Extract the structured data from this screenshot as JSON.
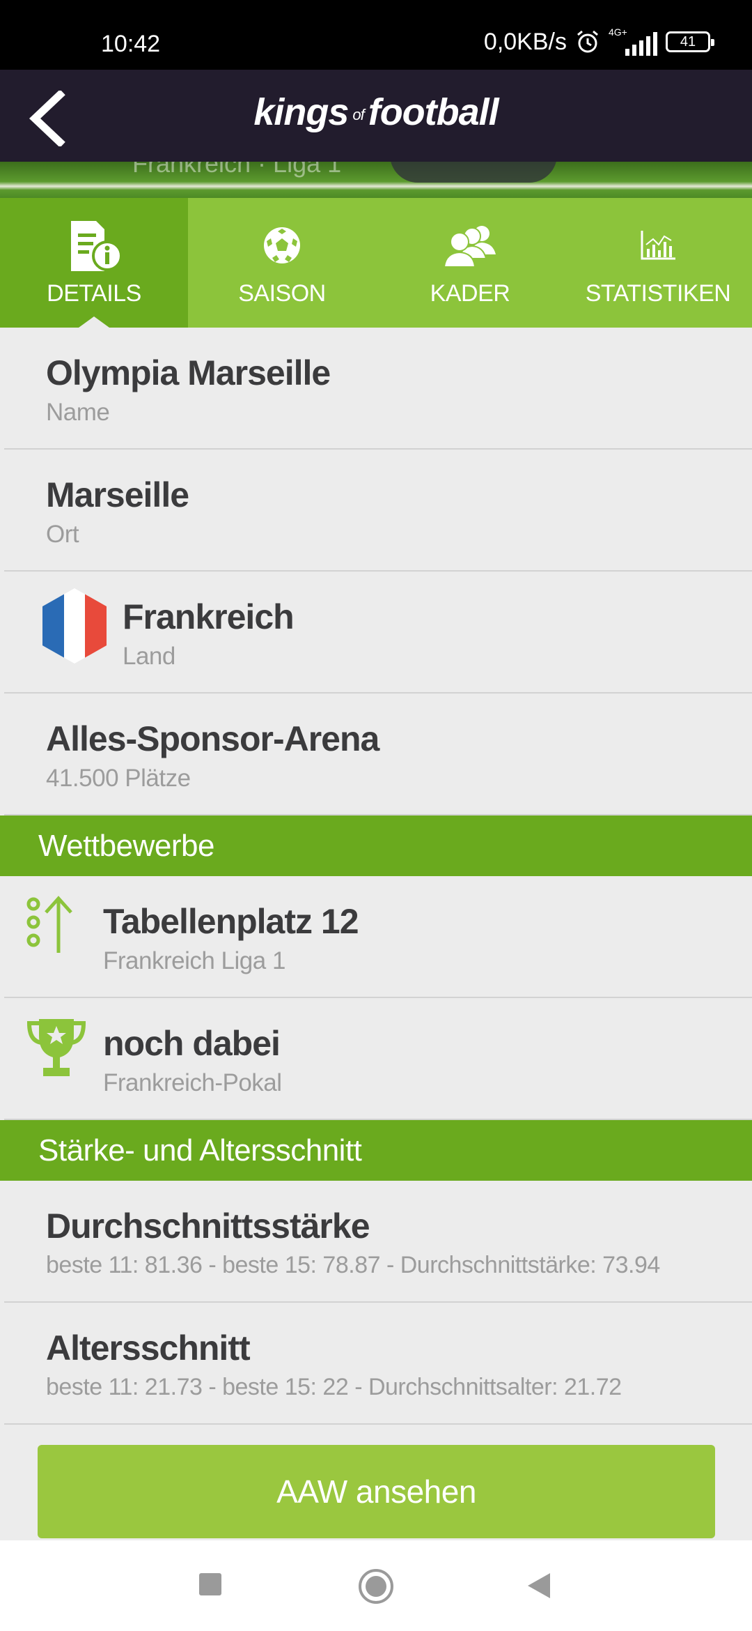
{
  "status_bar": {
    "time": "10:42",
    "network_speed": "0,0KB/s",
    "network_type": "4G+",
    "battery": "41"
  },
  "app": {
    "logo_left": "kings",
    "logo_of": "of",
    "logo_right": "football",
    "banner_text": "Frankreich · Liga 1"
  },
  "tabs": [
    {
      "label": "DETAILS",
      "icon": "details-icon",
      "active": true
    },
    {
      "label": "SAISON",
      "icon": "soccer-ball-icon",
      "active": false
    },
    {
      "label": "KADER",
      "icon": "squad-icon",
      "active": false
    },
    {
      "label": "STATISTIKEN",
      "icon": "chart-icon",
      "active": false
    }
  ],
  "details": {
    "name": {
      "value": "Olympia Marseille",
      "label": "Name"
    },
    "city": {
      "value": "Marseille",
      "label": "Ort"
    },
    "country": {
      "value": "Frankreich",
      "label": "Land",
      "flag_colors": [
        "#2a6bb5",
        "#ffffff",
        "#e84a3b"
      ]
    },
    "stadium": {
      "value": "Alles-Sponsor-Arena",
      "label": "41.500 Plätze"
    }
  },
  "competitions": {
    "header": "Wettbewerbe",
    "items": [
      {
        "title": "Tabellenplatz 12",
        "sub": "Frankreich Liga 1",
        "icon": "rank-up-icon"
      },
      {
        "title": "noch dabei",
        "sub": "Frankreich-Pokal",
        "icon": "trophy-icon"
      }
    ]
  },
  "strength": {
    "header": "Stärke- und Altersschnitt",
    "items": [
      {
        "title": "Durchschnittsstärke",
        "sub": "beste 11: 81.36 - beste 15: 78.87 - Durchschnittstärke: 73.94"
      },
      {
        "title": "Altersschnitt",
        "sub": "beste 11: 21.73 - beste 15: 22 - Durchschnittsalter: 21.72"
      }
    ]
  },
  "cta_label": "AAW ansehen",
  "colors": {
    "header_bg": "#221c2d",
    "tab_bg": "#8cc43b",
    "tab_active": "#6aaa1e",
    "section_bg": "#6aaa1e",
    "cta_bg": "#9ac73f",
    "icon_green": "#8cc43b"
  }
}
